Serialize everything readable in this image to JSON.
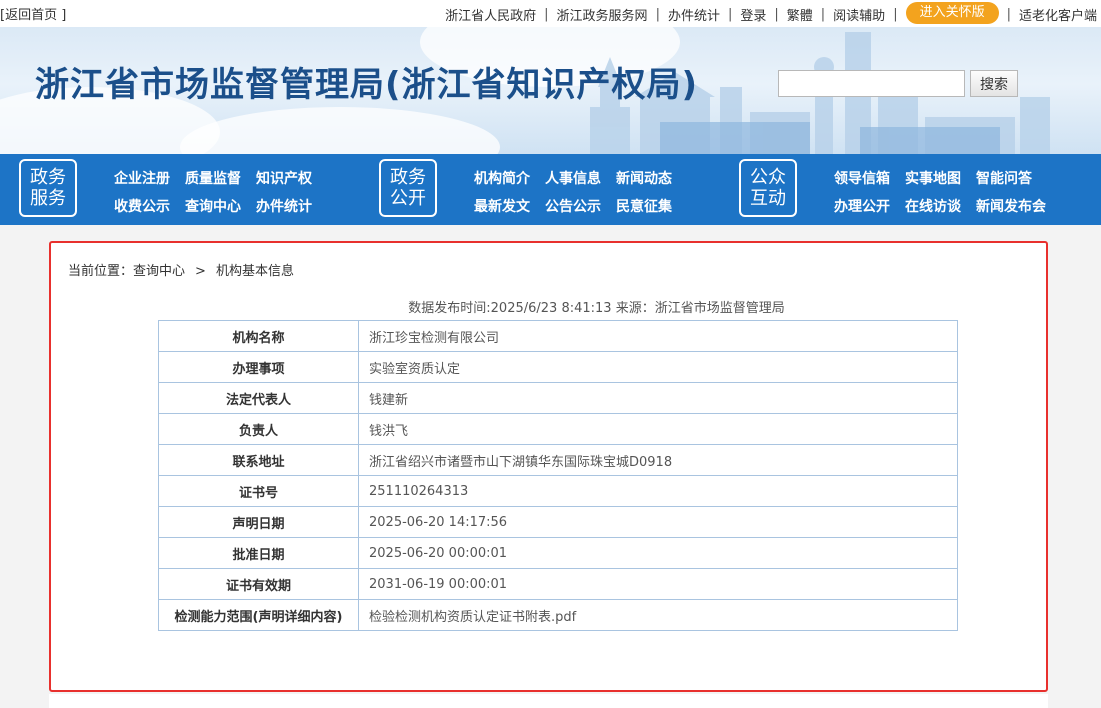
{
  "topbar": {
    "back_label": "[返回首页 ]",
    "links": [
      "浙江省人民政府",
      "浙江政务服务网",
      "办件统计",
      "登录",
      "繁體",
      "阅读辅助"
    ],
    "care_button": "进入关怀版",
    "elderly_link": "适老化客户端"
  },
  "banner": {
    "title": "浙江省市场监督管理局(浙江省知识产权局)",
    "search_placeholder": "",
    "search_button": "搜索"
  },
  "nav": {
    "groups": [
      {
        "box_line1": "政务",
        "box_line2": "服务",
        "items": [
          "企业注册",
          "质量监督",
          "知识产权",
          "收费公示",
          "查询中心",
          "办件统计"
        ]
      },
      {
        "box_line1": "政务",
        "box_line2": "公开",
        "items": [
          "机构简介",
          "人事信息",
          "新闻动态",
          "最新发文",
          "公告公示",
          "民意征集"
        ]
      },
      {
        "box_line1": "公众",
        "box_line2": "互动",
        "items": [
          "领导信箱",
          "实事地图",
          "智能问答",
          "办理公开",
          "在线访谈",
          "新闻发布会"
        ]
      }
    ]
  },
  "content": {
    "breadcrumb": {
      "prefix": "当前位置：",
      "crumb1": "查询中心",
      "sep": ">",
      "crumb2": "机构基本信息"
    },
    "meta": "数据发布时间:2025/6/23 8:41:13 来源：浙江省市场监督管理局",
    "rows": [
      {
        "key": "机构名称",
        "value": "浙江珍宝检测有限公司"
      },
      {
        "key": "办理事项",
        "value": "实验室资质认定"
      },
      {
        "key": "法定代表人",
        "value": "钱建新"
      },
      {
        "key": "负责人",
        "value": "钱洪飞"
      },
      {
        "key": "联系地址",
        "value": "浙江省绍兴市诸暨市山下湖镇华东国际珠宝城D0918"
      },
      {
        "key": "证书号",
        "value": "251110264313"
      },
      {
        "key": "声明日期",
        "value": "2025-06-20 14:17:56"
      },
      {
        "key": "批准日期",
        "value": "2025-06-20 00:00:01"
      },
      {
        "key": "证书有效期",
        "value": "2031-06-19 00:00:01"
      },
      {
        "key": "检测能力范围(声明详细内容)",
        "value": "检验检测机构资质认定证书附表.pdf"
      }
    ]
  },
  "colors": {
    "nav_bg": "#1d74c6",
    "title": "#1b4f8a",
    "highlight_border": "#e8302d",
    "care_button": "#f3a31e"
  }
}
